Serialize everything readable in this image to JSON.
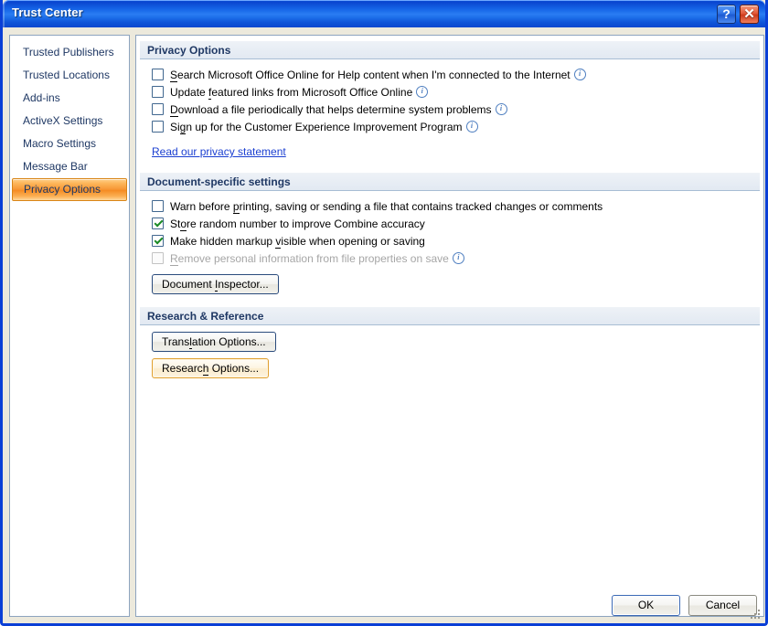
{
  "window": {
    "title": "Trust Center",
    "help_button": "?",
    "close_button": "✕"
  },
  "sidebar": {
    "items": [
      {
        "label": "Trusted Publishers",
        "selected": false
      },
      {
        "label": "Trusted Locations",
        "selected": false
      },
      {
        "label": "Add-ins",
        "selected": false
      },
      {
        "label": "ActiveX Settings",
        "selected": false
      },
      {
        "label": "Macro Settings",
        "selected": false
      },
      {
        "label": "Message Bar",
        "selected": false
      },
      {
        "label": "Privacy Options",
        "selected": true
      }
    ]
  },
  "sections": {
    "privacy": {
      "header": "Privacy Options",
      "checkboxes": [
        {
          "pre": "",
          "accel": "S",
          "post": "earch Microsoft Office Online for Help content when I'm connected to the Internet",
          "checked": false,
          "disabled": false,
          "info": true
        },
        {
          "pre": "Update ",
          "accel": "f",
          "post": "eatured links from Microsoft Office Online",
          "checked": false,
          "disabled": false,
          "info": true
        },
        {
          "pre": "",
          "accel": "D",
          "post": "ownload a file periodically that helps determine system problems",
          "checked": false,
          "disabled": false,
          "info": true
        },
        {
          "pre": "Si",
          "accel": "g",
          "post": "n up for the Customer Experience Improvement Program",
          "checked": false,
          "disabled": false,
          "info": true
        }
      ],
      "link": "Read our privacy statement"
    },
    "document": {
      "header": "Document-specific settings",
      "checkboxes": [
        {
          "pre": "Warn before ",
          "accel": "p",
          "post": "rinting, saving or sending a file that contains tracked changes or comments",
          "checked": false,
          "disabled": false,
          "info": false
        },
        {
          "pre": "St",
          "accel": "o",
          "post": "re random number to improve Combine accuracy",
          "checked": true,
          "disabled": false,
          "info": false
        },
        {
          "pre": "Make hidden markup ",
          "accel": "v",
          "post": "isible when opening or saving",
          "checked": true,
          "disabled": false,
          "info": false
        },
        {
          "pre": "",
          "accel": "R",
          "post": "emove personal information from file properties on save",
          "checked": false,
          "disabled": true,
          "info": true
        }
      ],
      "inspector_button": {
        "pre": "Document ",
        "accel": "I",
        "post": "nspector...",
        "hover": false
      }
    },
    "research": {
      "header": "Research & Reference",
      "buttons": [
        {
          "pre": "Trans",
          "accel": "l",
          "post": "ation Options...",
          "hover": false
        },
        {
          "pre": "Researc",
          "accel": "h",
          "post": " Options...",
          "hover": true
        }
      ]
    }
  },
  "footer": {
    "ok_label": "OK",
    "cancel_label": "Cancel"
  },
  "colors": {
    "titlebar_blue": "#1666e8",
    "selection_orange": "#f79634",
    "header_text": "#1f3864",
    "link_blue": "#1b3fd1",
    "check_green": "#1a8a24",
    "dialog_bg": "#ece9dc"
  }
}
